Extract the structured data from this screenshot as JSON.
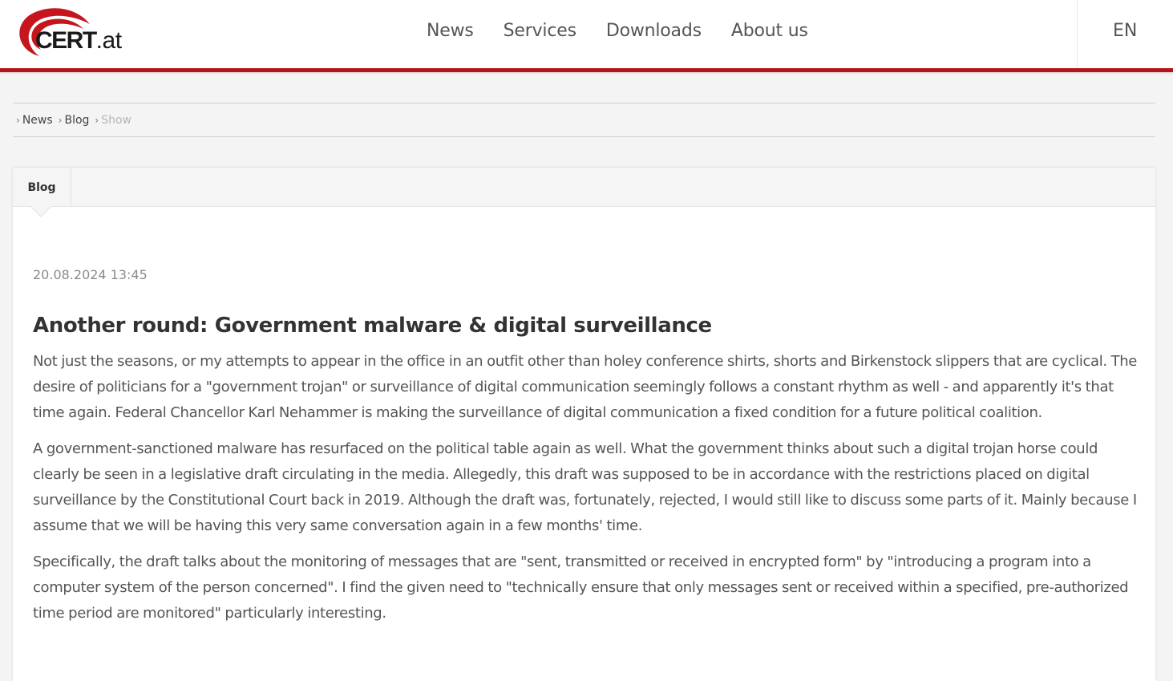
{
  "header": {
    "logo_text": "CERT",
    "logo_tld": ".at",
    "nav": [
      "News",
      "Services",
      "Downloads",
      "About us"
    ],
    "language": "EN"
  },
  "breadcrumb": [
    {
      "label": "News",
      "current": false
    },
    {
      "label": "Blog",
      "current": false
    },
    {
      "label": "Show",
      "current": true
    }
  ],
  "article": {
    "tab_label": "Blog",
    "date": "20.08.2024 13:45",
    "title": "Another round: Government malware & digital surveillance",
    "paragraphs": [
      "Not just the seasons, or my attempts to appear in the office in an outfit other than holey conference shirts, shorts and Birkenstock slippers that are cyclical. The desire of politicians for a \"government trojan\" or surveillance of digital communication seemingly follows a constant rhythm as well - and apparently it's that time again. Federal Chancellor Karl Nehammer is making the surveillance of digital communication a fixed condition for a future political coalition.",
      "A government-sanctioned malware has resurfaced on the political table again as well. What the government thinks about such a digital trojan horse could clearly be seen in a legislative draft circulating in the media. Allegedly, this draft was supposed to be in accordance with the restrictions placed on digital surveillance by the Constitutional Court back in 2019. Although the draft was, fortunately, rejected, I would still like to discuss some parts of it. Mainly because I assume that we will be having this very same conversation again in a few months' time.",
      "Specifically, the draft talks about the monitoring of messages that are \"sent, transmitted or received in encrypted form\" by \"introducing a program into a computer system of the person concerned\". I find the given need to \"technically ensure that only messages sent or received within a specified, pre-authorized time period are monitored\" particularly interesting."
    ]
  },
  "colors": {
    "brand_red": "#b4151d",
    "text": "#333333",
    "muted": "#8a8a8a"
  }
}
